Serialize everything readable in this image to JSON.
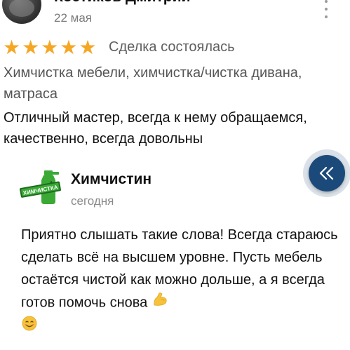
{
  "review": {
    "author": "Костиков Дмитрий",
    "date": "22 мая",
    "rating": 5,
    "deal_status": "Сделка состоялась",
    "services": "Химчистка мебели, химчистка/чистка дивана, матраса",
    "text": "Отличный мастер, всегда к нему обращаемся, качественно, всегда довольны"
  },
  "reply": {
    "author": "Химчистин",
    "date": "сегодня",
    "logo_text": "ХИМЧИСТКА",
    "text": "Приятно слышать такие слова! Всегда стараюсь сделать всё на высшем уровне. Пусть мебель остаётся чистой как можно дольше, а я всегда готов помочь снова"
  },
  "icons": {
    "more": "more-vertical-icon",
    "collapse": "double-chevron-left-icon",
    "star": "star-icon",
    "emoji_1": "flexed-biceps-emoji",
    "emoji_2": "smiling-face-emoji"
  },
  "colors": {
    "star": "#f5a623",
    "fab": "#1b4a7a",
    "secondary_text": "#5f5f5f",
    "logo_green": "#3aa935"
  }
}
